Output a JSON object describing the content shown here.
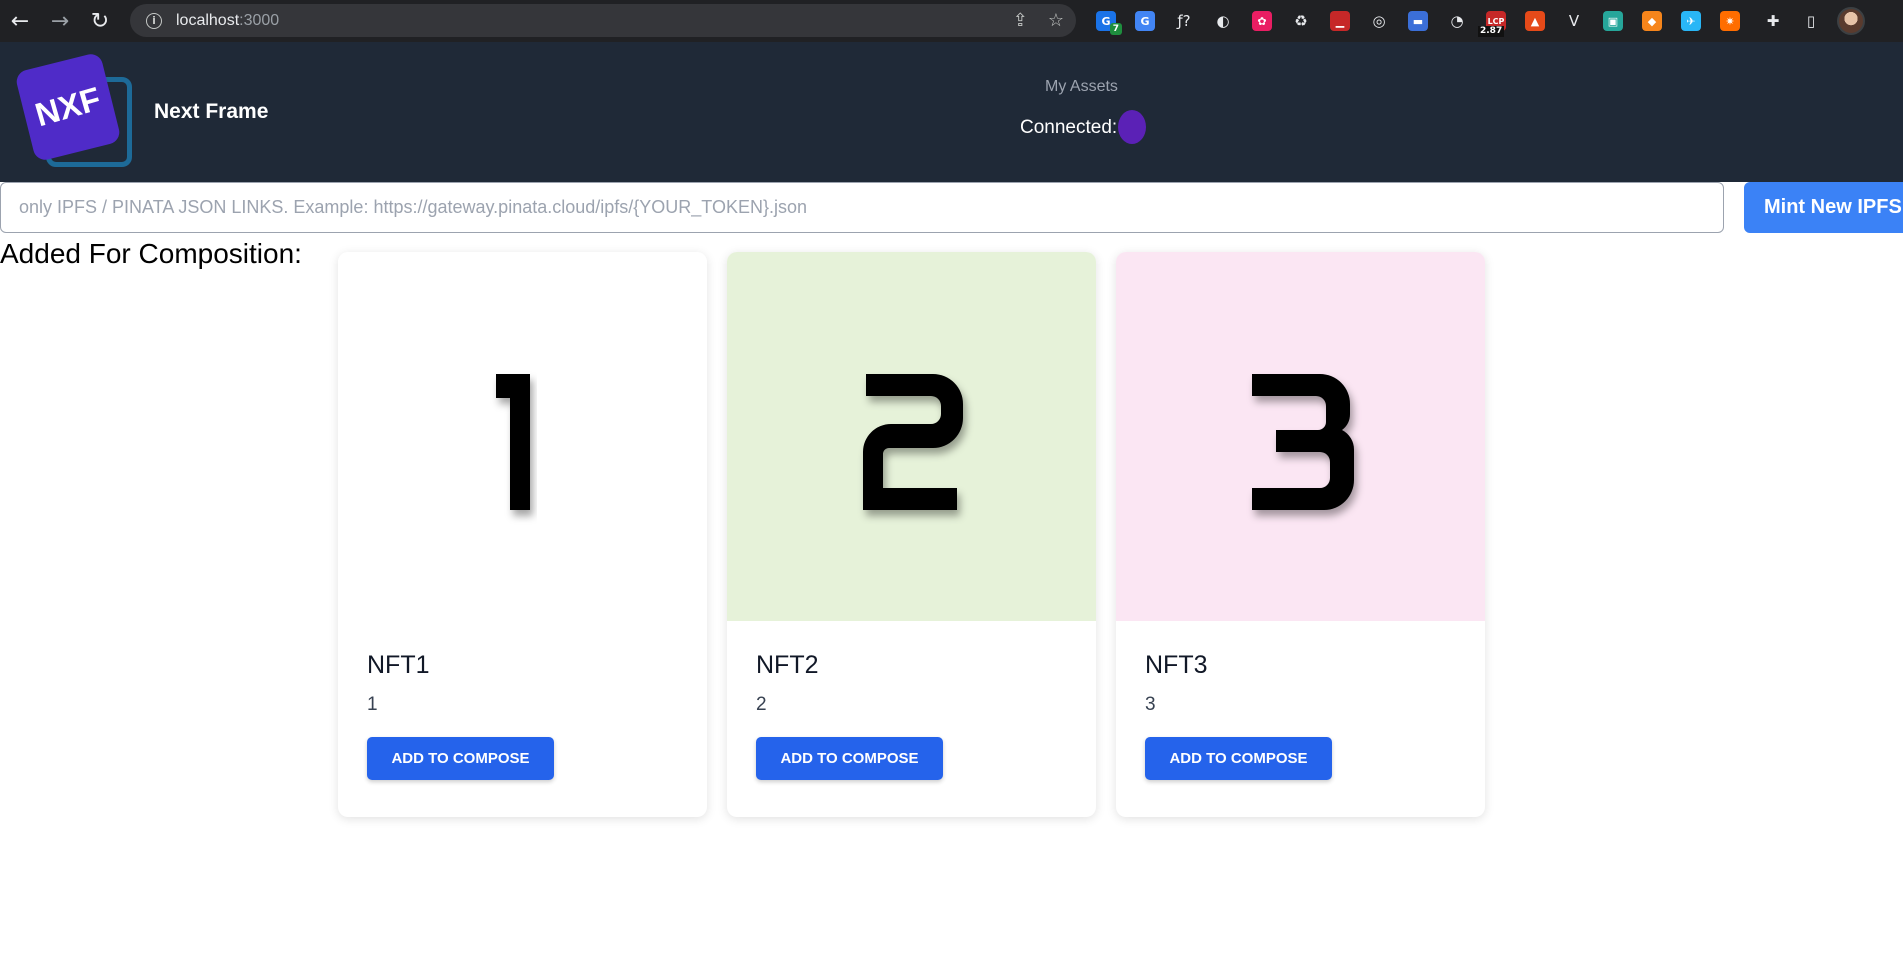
{
  "browser": {
    "url_host": "localhost",
    "url_port": ":3000",
    "extensions": [
      {
        "name": "grammar-extension-icon",
        "color": "#1a73e8",
        "glyph": "G",
        "badge": "7"
      },
      {
        "name": "translate-extension-icon",
        "color": "#4285f4",
        "glyph": "G",
        "badge": ""
      },
      {
        "name": "font-identifier-extension-icon",
        "color": "",
        "glyph": "ƒ?",
        "badge": ""
      },
      {
        "name": "circle-extension-icon",
        "color": "",
        "glyph": "◐",
        "badge": ""
      },
      {
        "name": "color-wheel-extension-icon",
        "color": "#e91e63",
        "glyph": "✿",
        "badge": ""
      },
      {
        "name": "recycle-extension-icon",
        "color": "",
        "glyph": "♻",
        "badge": ""
      },
      {
        "name": "chart-extension-icon",
        "color": "#c62828",
        "glyph": "▁",
        "badge": ""
      },
      {
        "name": "target-extension-icon",
        "color": "",
        "glyph": "◎",
        "badge": ""
      },
      {
        "name": "window-extension-icon",
        "color": "#3b6fd8",
        "glyph": "▬",
        "badge": ""
      },
      {
        "name": "spy-extension-icon",
        "color": "",
        "glyph": "◔",
        "badge": ""
      },
      {
        "name": "lcp-extension-icon",
        "color": "#c62828",
        "glyph": "LCP",
        "badge": "2.87"
      },
      {
        "name": "rocket-extension-icon",
        "color": "#e64a19",
        "glyph": "▲",
        "badge": ""
      },
      {
        "name": "vue-extension-icon",
        "color": "",
        "glyph": "V",
        "badge": ""
      },
      {
        "name": "save-extension-icon",
        "color": "#26a69a",
        "glyph": "▣",
        "badge": ""
      },
      {
        "name": "metamask-extension-icon",
        "color": "#f6851b",
        "glyph": "◆",
        "badge": ""
      },
      {
        "name": "bird-extension-icon",
        "color": "#29b6f6",
        "glyph": "✈",
        "badge": ""
      },
      {
        "name": "spark-extension-icon",
        "color": "#ff6d00",
        "glyph": "✷",
        "badge": ""
      }
    ]
  },
  "header": {
    "logo_text": "NXF",
    "brand": "Next Frame",
    "my_assets": "My Assets",
    "connected_label": "Connected:"
  },
  "mint": {
    "placeholder": "only IPFS / PINATA JSON LINKS. Example: https://gateway.pinata.cloud/ipfs/{YOUR_TOKEN}.json",
    "button_label": "Mint New IPFS"
  },
  "composition_title": "Added For Composition:",
  "cards": [
    {
      "title": "NFT1",
      "description": "1",
      "digit": "1",
      "bg": "#ffffff",
      "button": "ADD TO COMPOSE"
    },
    {
      "title": "NFT2",
      "description": "2",
      "digit": "2",
      "bg": "#e6f2d9",
      "button": "ADD TO COMPOSE"
    },
    {
      "title": "NFT3",
      "description": "3",
      "digit": "3",
      "bg": "#fbe6f3",
      "button": "ADD TO COMPOSE"
    }
  ]
}
